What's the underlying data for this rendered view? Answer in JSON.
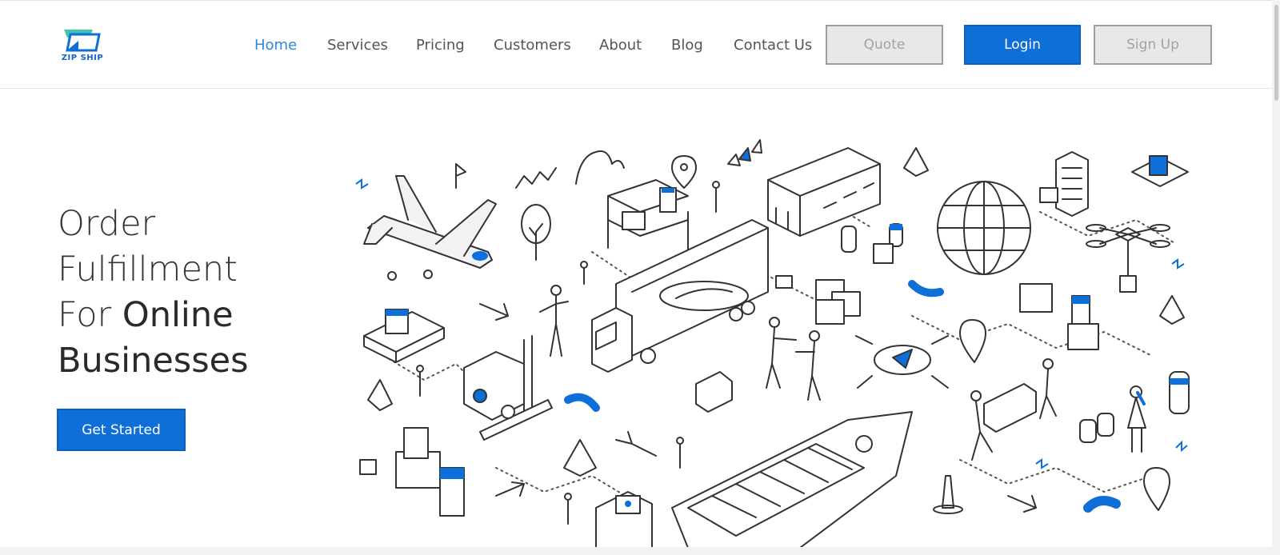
{
  "brand": {
    "name": "ZIP SHIP",
    "accent": "#0f6fd9",
    "logo_teal": "#3ec3b0"
  },
  "nav": {
    "items": [
      {
        "label": "Home",
        "active": true
      },
      {
        "label": "Services",
        "active": false
      },
      {
        "label": "Pricing",
        "active": false
      },
      {
        "label": "Customers",
        "active": false
      },
      {
        "label": "About",
        "active": false
      },
      {
        "label": "Blog",
        "active": false
      },
      {
        "label": "Contact Us",
        "active": false
      }
    ]
  },
  "buttons": {
    "quote": "Quote",
    "login": "Login",
    "signup": "Sign Up"
  },
  "hero": {
    "line1": "Order",
    "line2": "Fulfillment",
    "line3_light": "For",
    "line3_bold": "Online",
    "line4_bold": "Businesses",
    "cta": "Get Started"
  }
}
